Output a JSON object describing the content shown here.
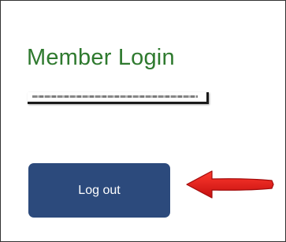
{
  "panel": {
    "title": "Member Login",
    "logout_label": "Log out",
    "accent_color": "#2f7a2f",
    "button_color": "#2c4a7c",
    "annotation": {
      "icon": "red-arrow-left-icon",
      "color": "#e21b1b"
    }
  }
}
